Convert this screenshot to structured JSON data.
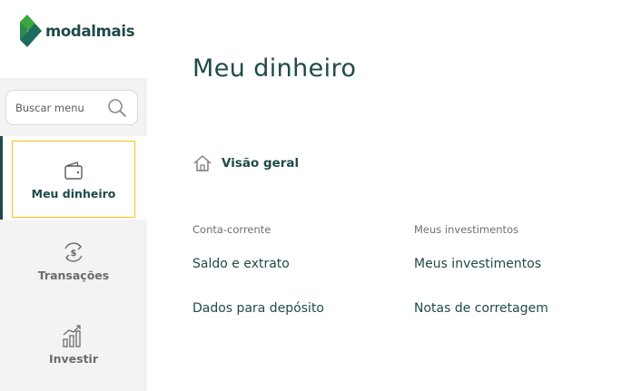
{
  "brand": {
    "name": "modalmais"
  },
  "search": {
    "placeholder": "Buscar menu"
  },
  "nav": {
    "items": [
      {
        "label": "Meu dinheiro",
        "icon": "wallet-icon"
      },
      {
        "label": "Transações",
        "icon": "money-transfer-icon"
      },
      {
        "label": "Investir",
        "icon": "growth-chart-icon"
      }
    ]
  },
  "page": {
    "title": "Meu dinheiro",
    "overview_label": "Visão geral",
    "sections": [
      {
        "heading": "Conta-corrente",
        "links": [
          "Saldo e extrato",
          "Dados para depósito"
        ]
      },
      {
        "heading": "Meus investimentos",
        "links": [
          "Meus investimentos",
          "Notas de corretagem"
        ]
      }
    ]
  },
  "colors": {
    "primary": "#1f4a49",
    "accent_yellow": "#f0c419",
    "logo_green": "#3ea63e",
    "sidebar_bg": "#f3f3f3"
  }
}
